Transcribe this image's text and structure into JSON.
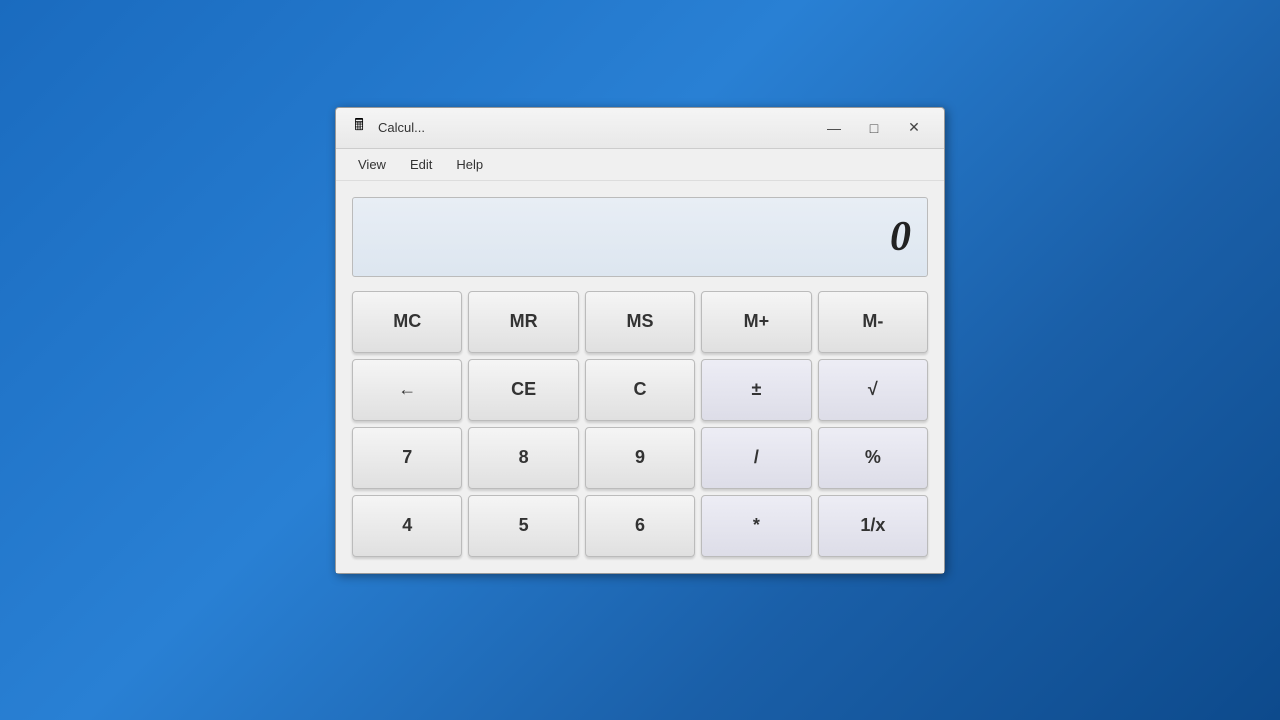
{
  "window": {
    "title": "Calcul...",
    "icon": "🖩"
  },
  "window_controls": {
    "minimize": "—",
    "maximize": "□",
    "close": "✕"
  },
  "menu": {
    "items": [
      "View",
      "Edit",
      "Help"
    ]
  },
  "display": {
    "value": "0"
  },
  "buttons": {
    "memory_row": [
      "MC",
      "MR",
      "MS",
      "M+",
      "M-"
    ],
    "control_row": [
      "←",
      "CE",
      "C",
      "±",
      "√"
    ],
    "row1": [
      "7",
      "8",
      "9",
      "/",
      "%"
    ],
    "row2": [
      "4",
      "5",
      "6",
      "*",
      "1/x"
    ]
  }
}
